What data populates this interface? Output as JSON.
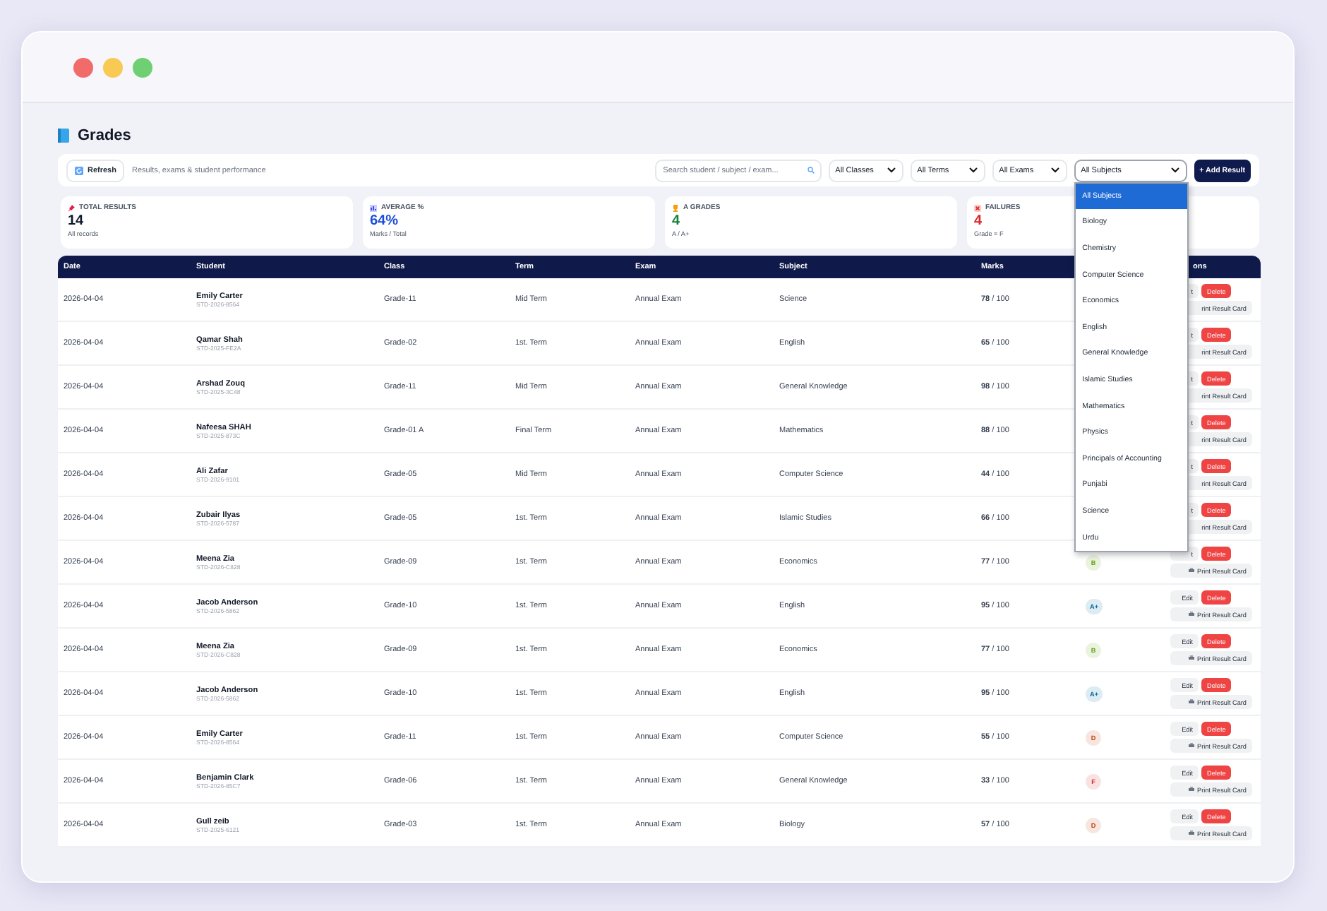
{
  "page": {
    "title": "Grades"
  },
  "toolbar": {
    "refresh": "Refresh",
    "subtitle": "Results, exams & student performance",
    "search": {
      "placeholder": "Search student / subject / exam..."
    },
    "filters": [
      {
        "value": "All Classes",
        "open": false
      },
      {
        "value": "All Terms",
        "open": false
      },
      {
        "value": "All Exams",
        "open": false
      },
      {
        "value": "All Subjects",
        "open": true,
        "options": [
          {
            "label": "All Subjects",
            "selected": true
          },
          {
            "label": "Biology",
            "selected": false
          },
          {
            "label": "Chemistry",
            "selected": false
          },
          {
            "label": "Computer Science",
            "selected": false
          },
          {
            "label": "Economics",
            "selected": false
          },
          {
            "label": "English",
            "selected": false
          },
          {
            "label": "General Knowledge",
            "selected": false
          },
          {
            "label": "Islamic Studies",
            "selected": false
          },
          {
            "label": "Mathematics",
            "selected": false
          },
          {
            "label": "Physics",
            "selected": false
          },
          {
            "label": "Principals of Accounting",
            "selected": false
          },
          {
            "label": "Punjabi",
            "selected": false
          },
          {
            "label": "Science",
            "selected": false
          },
          {
            "label": "Urdu",
            "selected": false
          }
        ]
      }
    ],
    "add_button": "+ Add Result"
  },
  "stats": [
    {
      "kind": "total",
      "label": "TOTAL RESULTS",
      "value": "14",
      "note": "All records",
      "color": "#0f172a"
    },
    {
      "kind": "average",
      "label": "AVERAGE %",
      "value": "64%",
      "note": "Marks / Total",
      "color": "#1d4ed8"
    },
    {
      "kind": "grades",
      "label": "A GRADES",
      "value": "4",
      "note": "A / A+",
      "color": "#15803d"
    },
    {
      "kind": "failures",
      "label": "FAILURES",
      "value": "4",
      "note": "Grade = F",
      "color": "#dc2626"
    }
  ],
  "table": {
    "columns": [
      "Date",
      "Student",
      "Class",
      "Term",
      "Exam",
      "Subject",
      "Marks",
      "ons"
    ],
    "rows": [
      {
        "date": "2026-04-04",
        "name": "Emily Carter",
        "id": "STD-2026-8564",
        "class": "Grade-11",
        "term": "Mid Term",
        "exam": "Annual Exam",
        "subject": "Science",
        "marks": "**78** / 100",
        "edit": "t",
        "delete": "Delete",
        "print": "rint Result Card",
        "print_icon": false
      },
      {
        "date": "2026-04-04",
        "name": "Qamar Shah",
        "id": "STD-2025-FE2A",
        "class": "Grade-02",
        "term": "1st. Term",
        "exam": "Annual Exam",
        "subject": "English",
        "marks": "**65** / 100",
        "edit": "t",
        "delete": "Delete",
        "print": "rint Result Card",
        "print_icon": false
      },
      {
        "date": "2026-04-04",
        "name": "Arshad Zouq",
        "id": "STD-2025-3C48",
        "class": "Grade-11",
        "term": "Mid Term",
        "exam": "Annual Exam",
        "subject": "General Knowledge",
        "marks": "**98** / 100",
        "edit": "t",
        "delete": "Delete",
        "print": "rint Result Card",
        "print_icon": false
      },
      {
        "date": "2026-04-04",
        "name": "Nafeesa SHAH",
        "id": "STD-2025-873C",
        "class": "Grade-01 A",
        "term": "Final Term",
        "exam": "Annual Exam",
        "subject": "Mathematics",
        "marks": "**88** / 100",
        "edit": "t",
        "delete": "Delete",
        "print": "rint Result Card",
        "print_icon": false
      },
      {
        "date": "2026-04-04",
        "name": "Ali Zafar",
        "id": "STD-2026-9101",
        "class": "Grade-05",
        "term": "Mid Term",
        "exam": "Annual Exam",
        "subject": "Computer Science",
        "marks": "**44** / 100",
        "edit": "t",
        "delete": "Delete",
        "print": "rint Result Card",
        "print_icon": false
      },
      {
        "date": "2026-04-04",
        "name": "Zubair Ilyas",
        "id": "STD-2026-5787",
        "class": "Grade-05",
        "term": "1st. Term",
        "exam": "Annual Exam",
        "subject": "Islamic Studies",
        "marks": "**66** / 100",
        "edit": "t",
        "delete": "Delete",
        "print": "rint Result Card",
        "print_icon": false
      },
      {
        "date": "2026-04-04",
        "name": "Meena Zia",
        "id": "STD-2026-C828",
        "class": "Grade-09",
        "term": "1st. Term",
        "exam": "Annual Exam",
        "subject": "Economics",
        "marks": "**77** / 100",
        "grade": {
          "label": "B",
          "color": "#65a30d"
        },
        "edit": "t",
        "delete": "Delete",
        "print": "Print Result Card",
        "print_icon": true
      },
      {
        "date": "2026-04-04",
        "name": "Jacob Anderson",
        "id": "STD-2026-5862",
        "class": "Grade-10",
        "term": "1st. Term",
        "exam": "Annual Exam",
        "subject": "English",
        "marks": "**95** / 100",
        "grade": {
          "label": "A+",
          "color": "#0369a1"
        },
        "edit": "Edit",
        "delete": "Delete",
        "print": "Print Result Card",
        "print_icon": true
      },
      {
        "date": "2026-04-04",
        "name": "Meena Zia",
        "id": "STD-2026-C828",
        "class": "Grade-09",
        "term": "1st. Term",
        "exam": "Annual Exam",
        "subject": "Economics",
        "marks": "**77** / 100",
        "grade": {
          "label": "B",
          "color": "#65a30d"
        },
        "edit": "Edit",
        "delete": "Delete",
        "print": "Print Result Card",
        "print_icon": true
      },
      {
        "date": "2026-04-04",
        "name": "Jacob Anderson",
        "id": "STD-2026-5862",
        "class": "Grade-10",
        "term": "1st. Term",
        "exam": "Annual Exam",
        "subject": "English",
        "marks": "**95** / 100",
        "grade": {
          "label": "A+",
          "color": "#0369a1"
        },
        "edit": "Edit",
        "delete": "Delete",
        "print": "Print Result Card",
        "print_icon": true
      },
      {
        "date": "2026-04-04",
        "name": "Emily Carter",
        "id": "STD-2026-8564",
        "class": "Grade-11",
        "term": "1st. Term",
        "exam": "Annual Exam",
        "subject": "Computer Science",
        "marks": "**55** / 100",
        "grade": {
          "label": "D",
          "color": "#c2410c"
        },
        "edit": "Edit",
        "delete": "Delete",
        "print": "Print Result Card",
        "print_icon": true
      },
      {
        "date": "2026-04-04",
        "name": "Benjamin Clark",
        "id": "STD-2026-85C7",
        "class": "Grade-06",
        "term": "1st. Term",
        "exam": "Annual Exam",
        "subject": "General Knowledge",
        "marks": "**33** / 100",
        "grade": {
          "label": "F",
          "color": "#dc2626"
        },
        "edit": "Edit",
        "delete": "Delete",
        "print": "Print Result Card",
        "print_icon": true
      },
      {
        "date": "2026-04-04",
        "name": "Gull zeib",
        "id": "STD-2025-6121",
        "class": "Grade-03",
        "term": "1st. Term",
        "exam": "Annual Exam",
        "subject": "Biology",
        "marks": "**57** / 100",
        "grade": {
          "label": "D",
          "color": "#c2410c"
        },
        "edit": "Edit",
        "delete": "Delete",
        "print": "Print Result Card",
        "print_icon": true
      }
    ]
  }
}
